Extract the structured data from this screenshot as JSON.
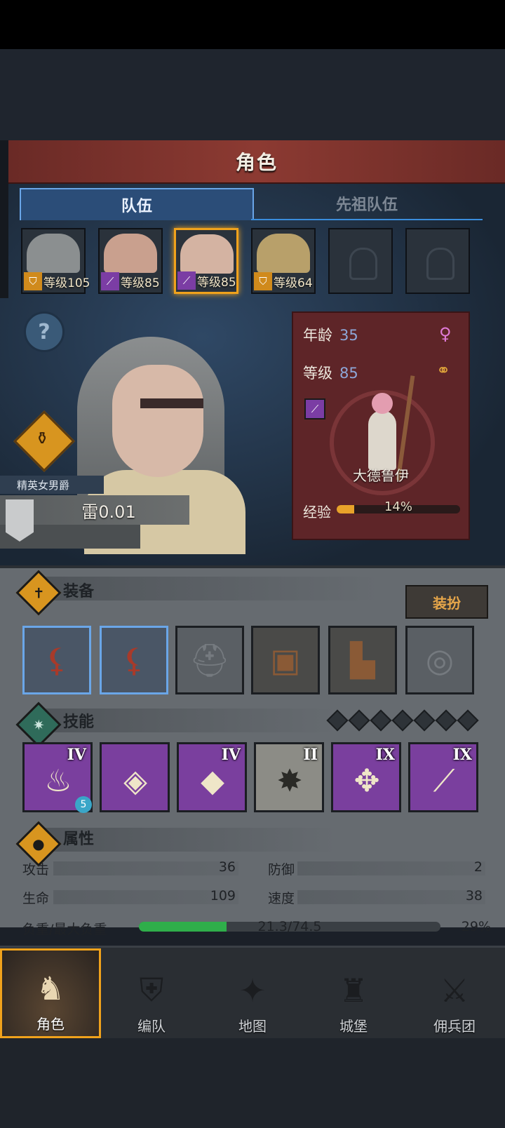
{
  "header": {
    "title": "角色"
  },
  "tabs": [
    {
      "label": "队伍",
      "active": true
    },
    {
      "label": "先祖队伍",
      "active": false
    }
  ],
  "party": [
    {
      "level_text": "等级105",
      "class_icon": "shield-icon",
      "class_color": "#d08a1c",
      "portrait_color": "#8b8f90"
    },
    {
      "level_text": "等级85",
      "class_icon": "staff-icon",
      "class_color": "#7b3da4",
      "portrait_color": "#c9a08e"
    },
    {
      "level_text": "等级85",
      "class_icon": "staff-icon",
      "class_color": "#7b3da4",
      "portrait_color": "#d4b3a2",
      "selected": true
    },
    {
      "level_text": "等级64",
      "class_icon": "shield-icon",
      "class_color": "#d08a1c",
      "portrait_color": "#b8a06a"
    },
    {
      "empty": true
    },
    {
      "empty": true
    }
  ],
  "hero": {
    "rank": "精英女男爵",
    "name": "雷0.01",
    "age_label": "年龄",
    "age": "35",
    "level_label": "等级",
    "level": "85",
    "class_name": "大德鲁伊",
    "exp_label": "经验",
    "exp_percent_text": "14%",
    "exp_fraction": 0.14
  },
  "equipment": {
    "title": "装备",
    "dress_button": "装扮",
    "slots": [
      {
        "name": "weapon-slot-1",
        "icon": "claw-weapon-icon",
        "style": "blue"
      },
      {
        "name": "weapon-slot-2",
        "icon": "claw-weapon-icon",
        "style": "blue"
      },
      {
        "name": "helmet-slot",
        "icon": "helmet-icon",
        "style": "empty"
      },
      {
        "name": "armor-slot",
        "icon": "coat-icon",
        "style": "brown"
      },
      {
        "name": "boots-slot",
        "icon": "boots-icon",
        "style": "brown"
      },
      {
        "name": "ring-slot",
        "icon": "ring-icon",
        "style": "empty"
      }
    ]
  },
  "skills": {
    "title": "技能",
    "gem_count": 7,
    "items": [
      {
        "tier": "IV",
        "icon": "flame-icon",
        "glyph": "♨",
        "grey": false,
        "badge": "5"
      },
      {
        "tier": "",
        "icon": "whirlwind-crystal-icon",
        "glyph": "◈",
        "grey": false
      },
      {
        "tier": "IV",
        "icon": "crystal-hand-icon",
        "glyph": "◆",
        "grey": false
      },
      {
        "tier": "II",
        "icon": "burst-icon",
        "glyph": "✸",
        "grey": true
      },
      {
        "tier": "IX",
        "icon": "crosshair-icon",
        "glyph": "✥",
        "grey": false
      },
      {
        "tier": "IX",
        "icon": "spear-icon",
        "glyph": "⟋",
        "grey": false
      }
    ]
  },
  "attributes": {
    "title": "属性",
    "attack_label": "攻击",
    "attack": "36",
    "defense_label": "防御",
    "defense": "2",
    "hp_label": "生命",
    "hp": "109",
    "speed_label": "速度",
    "speed": "38",
    "load_label": "负重/最大负重",
    "load_text": "21.3/74.5",
    "load_percent_text": "29%",
    "load_fraction": 0.29
  },
  "nav": [
    {
      "label": "角色",
      "icon": "knight-icon",
      "glyph": "♞",
      "active": true
    },
    {
      "label": "编队",
      "icon": "formation-helmet-icon",
      "glyph": "⛨",
      "active": false
    },
    {
      "label": "地图",
      "icon": "compass-map-icon",
      "glyph": "✦",
      "active": false
    },
    {
      "label": "城堡",
      "icon": "castle-icon",
      "glyph": "♜",
      "active": false
    },
    {
      "label": "佣兵团",
      "icon": "mercenary-banner-icon",
      "glyph": "⚔",
      "active": false
    }
  ],
  "colors": {
    "accent": "#f0a21c",
    "tab_blue": "#6aa6e8",
    "exp": "#e8a22a",
    "load": "#2fae4a"
  }
}
